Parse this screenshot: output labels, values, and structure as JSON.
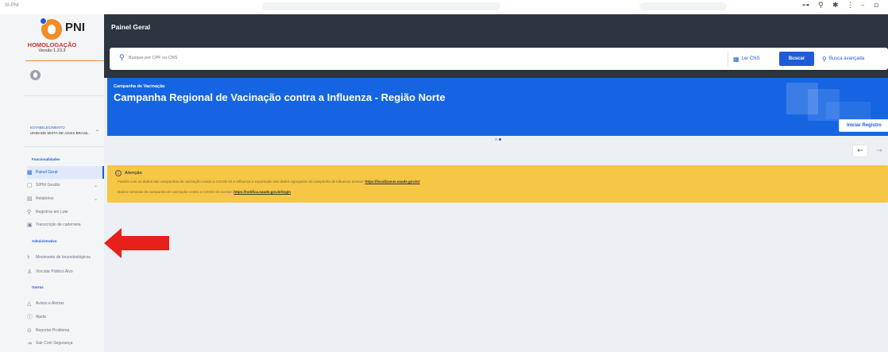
{
  "app_id": "SI-PNI",
  "sidebar": {
    "brand": "PNI",
    "environment": "HOMOLOGAÇÃO",
    "version": "Versão 1.23.3",
    "establishment_label": "ESTABELECIMENTO",
    "establishment_value": "UNIDADE MISTA DE ASSIS BRASIL",
    "sections": {
      "functionalities": "Funcionalidades",
      "administrative": "Administrativo",
      "others": "Outros"
    },
    "items": [
      {
        "label": "Painel Geral",
        "icon": "dashboard-icon",
        "glyph": "▦"
      },
      {
        "label": "SIPNI Gestão",
        "icon": "document-icon",
        "glyph": "▢"
      },
      {
        "label": "Relatórios",
        "icon": "report-icon",
        "glyph": "▤"
      },
      {
        "label": "Registros em Lote",
        "icon": "syringe-icon",
        "glyph": "⚲"
      },
      {
        "label": "Transcrição de caderneta",
        "icon": "transcript-icon",
        "glyph": "▣"
      },
      {
        "label": "Movimento de Imunobiológicos",
        "icon": "vaccine-icon",
        "glyph": "⚕"
      },
      {
        "label": "Vincular Público Alvo",
        "icon": "user-icon",
        "glyph": "♙"
      },
      {
        "label": "Avisos e Alertas",
        "icon": "bell-icon",
        "glyph": "△"
      },
      {
        "label": "Ajuda",
        "icon": "help-icon",
        "glyph": "ⓘ"
      },
      {
        "label": "Reportar Problema",
        "icon": "report-problem-icon",
        "glyph": "⊙"
      },
      {
        "label": "Sair Com Segurança",
        "icon": "logout-icon",
        "glyph": "⇥"
      }
    ]
  },
  "header": {
    "title": "Painel Geral"
  },
  "search": {
    "placeholder": "Busque por CPF ou CNS",
    "read_cns": "Ler CNS",
    "search_button": "Buscar",
    "advanced": "Busca avançada"
  },
  "banner": {
    "kicker": "Campanha de Vacinação",
    "title": "Campanha Regional de Vacinação contra a Influenza - Região Norte",
    "start_button": "Iniciar Registro"
  },
  "alert": {
    "title": "Atenção",
    "line1_text": "Painéis com os dados das campanhas de vacinação contra a COVID-19 e Influenza e exportação dos dados agregados da campanha de influenza acesse:",
    "line1_link": "https://localizasus.saude.gov.br/",
    "line2_text": "Dados nominais da campanha de vacinação contra a COVID-19 acesse:",
    "line2_link": "https://notifica.saude.gov.br/login"
  },
  "colors": {
    "primary": "#1e5bd8",
    "header": "#2c3540",
    "banner": "#1565e3",
    "alert": "#f5c744",
    "logo": "#f28c28",
    "env_red": "#d0302a",
    "annotation_red": "#e8201b"
  }
}
